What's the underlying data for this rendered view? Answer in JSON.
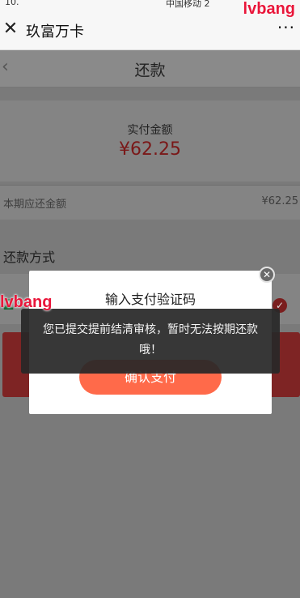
{
  "status_bar": {
    "left": "10.",
    "mid": "中国移动 2"
  },
  "wx_bar": {
    "close_glyph": "✕",
    "title": "玖富万卡",
    "more_glyph": "···"
  },
  "watermark": "lvbang",
  "nav": {
    "back_glyph": "‹",
    "title": "还款"
  },
  "amount": {
    "label": "实付金额",
    "value": "¥62.25"
  },
  "due": {
    "label": "本期应还金额",
    "value": "¥62.25"
  },
  "method": {
    "label": "还款方式",
    "icon_glyph": "Z",
    "check_glyph": "✓"
  },
  "modal": {
    "title": "输入支付验证码",
    "button_label": "确认支付",
    "close_glyph": "✕"
  },
  "toast": {
    "message": "您已提交提前结清审核，暂时无法按期还款哦！"
  },
  "colors": {
    "accent": "#ff6a4a",
    "amount_red": "#e4393c",
    "watermark": "#e9163a"
  }
}
